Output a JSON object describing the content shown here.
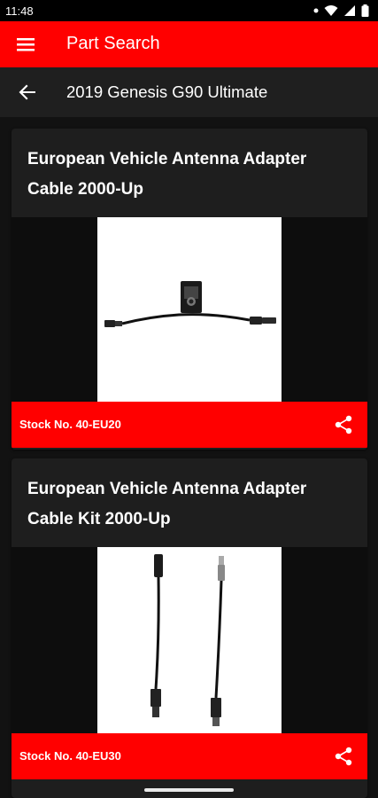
{
  "status_bar": {
    "time": "11:48",
    "icons": [
      "dot-icon",
      "wifi-icon",
      "signal-icon",
      "battery-icon"
    ]
  },
  "app_bar": {
    "title": "Part Search",
    "menu_icon": "hamburger-menu-icon",
    "color": "#ff0000"
  },
  "sub_bar": {
    "title": "2019 Genesis G90 Ultimate",
    "back_icon": "arrow-left-icon"
  },
  "parts": [
    {
      "title_line1": "European Vehicle Antenna Adapter",
      "title_line2": "Cable 2000-Up",
      "stock": "Stock No. 40-EU20",
      "share_icon": "share-icon"
    },
    {
      "title_line1": "European Vehicle Antenna Adapter",
      "title_line2": "Cable Kit 2000-Up",
      "stock": "Stock No. 40-EU30",
      "share_icon": "share-icon"
    }
  ],
  "colors": {
    "accent": "#ff0000",
    "background": "#121212",
    "card": "#1e1e1e",
    "text": "#ffffff"
  }
}
